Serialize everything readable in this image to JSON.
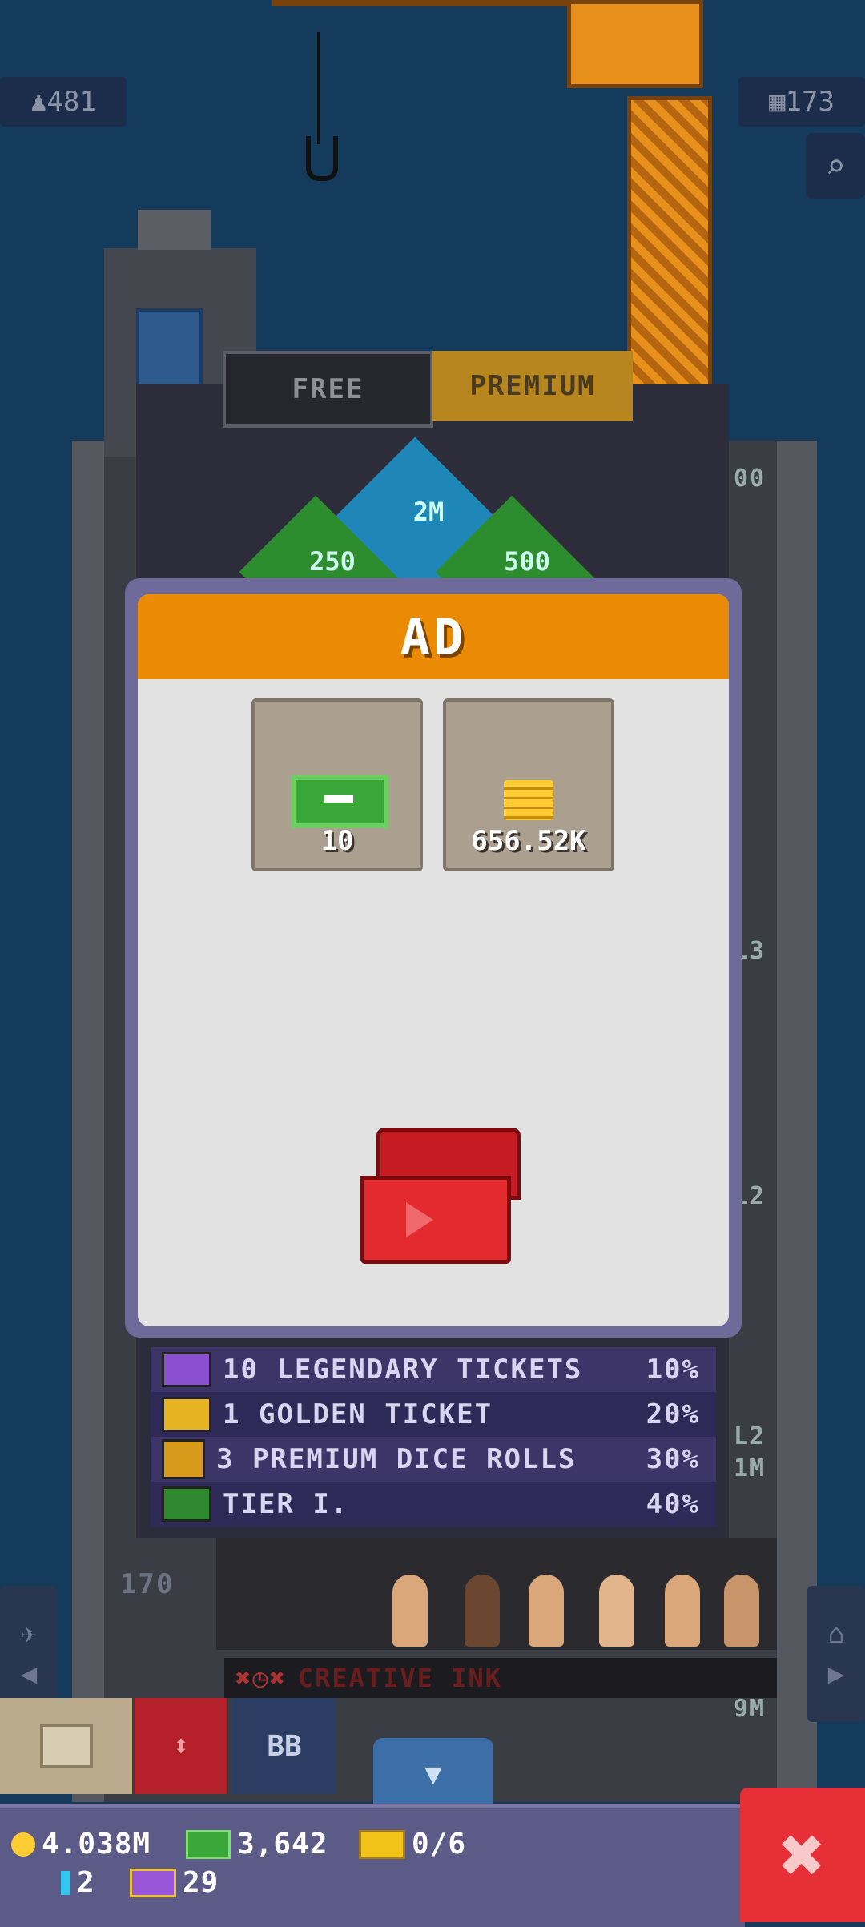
{
  "hud": {
    "population": "481",
    "floors": "173",
    "zoom_icon": "magnifier-icon"
  },
  "lottery": {
    "tabs": {
      "free": "FREE",
      "premium": "PREMIUM"
    },
    "grid": {
      "top": "2M",
      "left": "250",
      "right": "500",
      "right_edge": "00"
    }
  },
  "ad_dialog": {
    "title": "AD",
    "rewards": [
      {
        "icon": "bux-ticket-icon",
        "amount": "10"
      },
      {
        "icon": "coins-icon",
        "amount": "656.52K"
      }
    ],
    "chest_icon": "video-chest-icon"
  },
  "odds": [
    {
      "label": "10 LEGENDARY TICKETS",
      "chance": "10%",
      "icon": "legendary-ticket-icon",
      "color": "#8a4fd1"
    },
    {
      "label": "1 GOLDEN TICKET",
      "chance": "20%",
      "icon": "golden-ticket-icon",
      "color": "#e6b422"
    },
    {
      "label": "3 PREMIUM DICE ROLLS",
      "chance": "30%",
      "icon": "dice-icon",
      "color": "#d89a1a"
    },
    {
      "label": "TIER I.",
      "chance": "40%",
      "icon": "green-crate-icon",
      "color": "#2f8a2f"
    }
  ],
  "tower": {
    "floor_number": "170",
    "business_name": "CREATIVE INK",
    "side_labels": [
      "L2",
      "9M",
      "L3",
      "L2",
      "1M",
      "L2",
      "9M"
    ]
  },
  "toolbar": {
    "bb_label": "BB"
  },
  "status": {
    "coins": "4.038M",
    "bux": "3,642",
    "golden_tickets": "0/6",
    "gems": "2",
    "legendary_tickets": "29"
  }
}
